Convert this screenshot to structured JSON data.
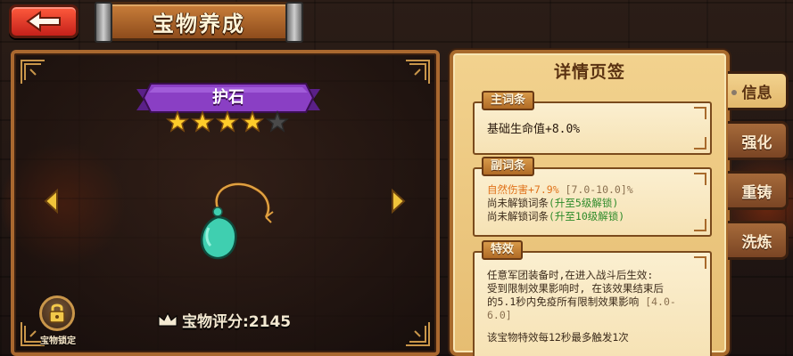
{
  "header": {
    "back_label": "",
    "title": "宝物养成"
  },
  "item": {
    "name": "护石",
    "stars_filled": 4,
    "stars_total": 5,
    "score_text": "宝物评分:2145",
    "lock_label": "宝物锁定"
  },
  "details": {
    "title": "详情页签",
    "main_tab": "主词条",
    "main_stat": "基础生命值+8.0%",
    "sub_tab": "副词条",
    "sub_stat_value": "自然伤害+7.9%",
    "sub_stat_range": " [7.0-10.0]%",
    "sub_locked_1": "尚未解锁词条",
    "sub_locked_1_hint": "(升至5级解锁)",
    "sub_locked_2": "尚未解锁词条",
    "sub_locked_2_hint": "(升至10级解锁)",
    "effect_tab": "特效",
    "effect_line_1": "任意军团装备时,在进入战斗后生效:",
    "effect_line_2": "受到限制效果影响时, 在该效果结束后",
    "effect_line_3a": "的5.1秒内免疫所有限制效果影响",
    "effect_line_3b": " [4.0-",
    "effect_line_4": "6.0]",
    "effect_line_5": "该宝物特效每12秒最多触发1次"
  },
  "side_tabs": [
    "信息",
    "强化",
    "重铸",
    "洗炼"
  ],
  "colors": {
    "accent_orange": "#e0731c",
    "unlock_green": "#2e8b2a",
    "banner_purple": "#8a3fc4",
    "gem_teal": "#3fcfb0"
  }
}
